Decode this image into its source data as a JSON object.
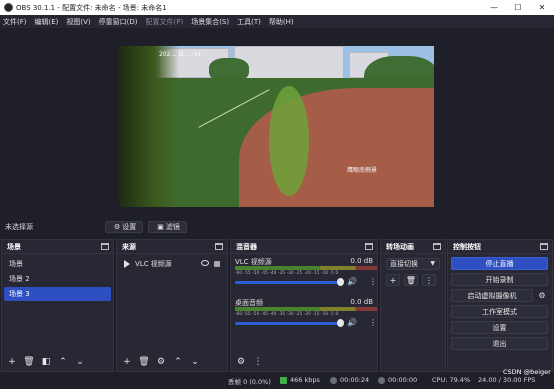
{
  "window": {
    "title": "OBS 30.1.1 - 配置文件: 未命名 - 场景: 未命名1",
    "controls": [
      "—",
      "☐",
      "✕"
    ]
  },
  "menu": [
    {
      "label": "文件(F)",
      "disabled": false
    },
    {
      "label": "编辑(E)",
      "disabled": false
    },
    {
      "label": "视图(V)",
      "disabled": false
    },
    {
      "label": "停靠窗口(D)",
      "disabled": false
    },
    {
      "label": "配置文件(P)",
      "disabled": true
    },
    {
      "label": "场景集合(S)",
      "disabled": false
    },
    {
      "label": "工具(T)",
      "disabled": false
    },
    {
      "label": "帮助(H)",
      "disabled": false
    }
  ],
  "preview": {
    "timestamp": "202... 日 ...:41",
    "watermark": "鹰眼南侧景"
  },
  "scene_toolbar": {
    "no_source": "未选择源",
    "settings_label": "设置",
    "filters_label": "滤镜"
  },
  "docks": {
    "scenes": {
      "title": "场景",
      "items": [
        "场景",
        "场景 2",
        "场景 3"
      ],
      "selected": 2
    },
    "sources": {
      "title": "来源",
      "items": [
        {
          "name": "VLC 视频源",
          "visible": true,
          "locked": true
        }
      ]
    },
    "mixer": {
      "title": "混音器",
      "channels": [
        {
          "name": "VLC 视频源",
          "db": "0.0 dB",
          "volume_fraction": 0.92
        },
        {
          "name": "桌面音频",
          "db": "0.0 dB",
          "volume_fraction": 0.92
        }
      ],
      "scale": "-60 -55 -50 -45 -40 -35 -30 -25 -20 -15 -10 -5 0"
    },
    "transitions": {
      "title": "转场动画",
      "selected": "直接切换"
    },
    "controls": {
      "title": "控制按钮",
      "stop_stream": "停止直播",
      "start_record": "开始录制",
      "virtual_cam": "启动虚拟摄像机",
      "studio_mode": "工作室模式",
      "settings": "设置",
      "exit": "退出"
    }
  },
  "status": {
    "dropped": "丢帧 0 (0.0%)",
    "bitrate": "466 kbps",
    "stream_time": "00:00:24",
    "record_time": "00:00:00",
    "cpu": "CPU: 79.4%",
    "fps": "24.00 / 30.00 FPS",
    "watermark": "CSDN @beiger"
  }
}
